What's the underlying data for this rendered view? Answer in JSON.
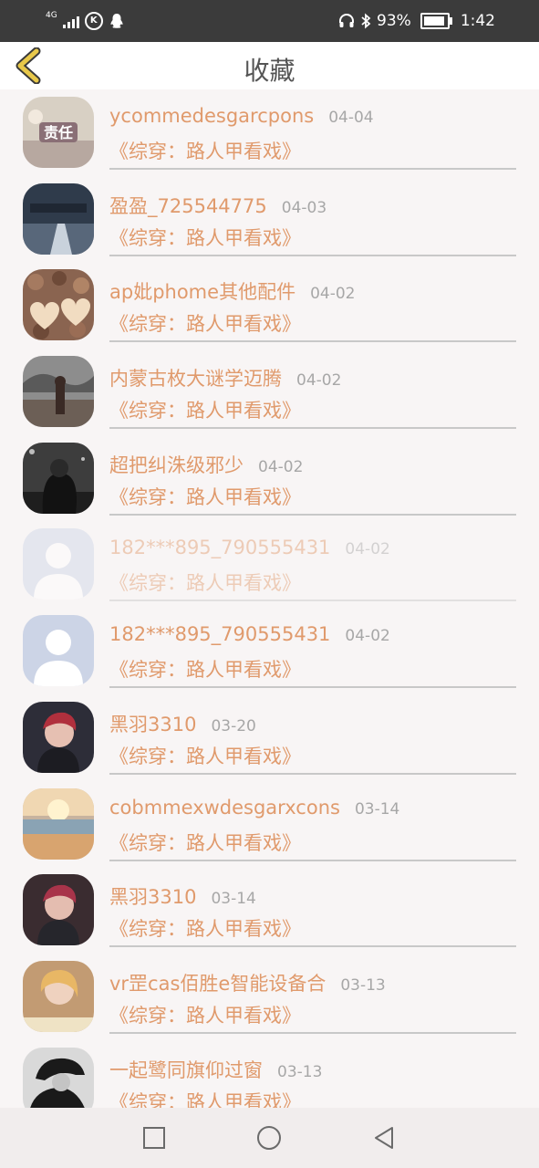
{
  "status_bar": {
    "network": "4G",
    "battery_percent": "93%",
    "battery_level": 0.93,
    "time": "1:42"
  },
  "header": {
    "title": "收藏"
  },
  "colors": {
    "accent": "#e09a6c",
    "back_icon": "#e8c84a",
    "date": "#a7a7a7",
    "status_bar_bg": "#3b3b3b"
  },
  "favorites": [
    {
      "user": "ycommedesgarcpons",
      "date": "04-04",
      "book": "《综穿：路人甲看戏》",
      "avatar_icon": "photo-avatar-icon",
      "avatar_text": "责任",
      "faded": false
    },
    {
      "user": "盈盈_725544775",
      "date": "04-03",
      "book": "《综穿：路人甲看戏》",
      "avatar_icon": "photo-avatar-icon",
      "faded": false
    },
    {
      "user": "ap妣phome其他配件",
      "date": "04-02",
      "book": "《综穿：路人甲看戏》",
      "avatar_icon": "photo-avatar-icon",
      "faded": false
    },
    {
      "user": "内蒙古枚大谜学迈腾",
      "date": "04-02",
      "book": "《综穿：路人甲看戏》",
      "avatar_icon": "photo-avatar-icon",
      "faded": false
    },
    {
      "user": "超把纠洙级邪少",
      "date": "04-02",
      "book": "《综穿：路人甲看戏》",
      "avatar_icon": "photo-avatar-icon",
      "faded": false
    },
    {
      "user": "182***895_790555431",
      "date": "04-02",
      "book": "《综穿：路人甲看戏》",
      "avatar_icon": "default-avatar-icon",
      "faded": true
    },
    {
      "user": "182***895_790555431",
      "date": "04-02",
      "book": "《综穿：路人甲看戏》",
      "avatar_icon": "default-avatar-icon",
      "faded": false
    },
    {
      "user": "黑羽3310",
      "date": "03-20",
      "book": "《综穿：路人甲看戏》",
      "avatar_icon": "photo-avatar-icon",
      "faded": false
    },
    {
      "user": "cobmmexwdesgarxcons",
      "date": "03-14",
      "book": "《综穿：路人甲看戏》",
      "avatar_icon": "photo-avatar-icon",
      "faded": false
    },
    {
      "user": "黑羽3310",
      "date": "03-14",
      "book": "《综穿：路人甲看戏》",
      "avatar_icon": "photo-avatar-icon",
      "faded": false
    },
    {
      "user": "vr罡cas佰胜e智能设备合",
      "date": "03-13",
      "book": "《综穿：路人甲看戏》",
      "avatar_icon": "photo-avatar-icon",
      "faded": false
    },
    {
      "user": "一起鹭同旗仰过窗",
      "date": "03-13",
      "book": "《综穿：路人甲看戏》",
      "avatar_icon": "photo-avatar-icon",
      "faded": false
    }
  ],
  "nav_bar": {
    "recents_icon": "square-icon",
    "home_icon": "circle-icon",
    "back_icon": "triangle-back-icon"
  }
}
